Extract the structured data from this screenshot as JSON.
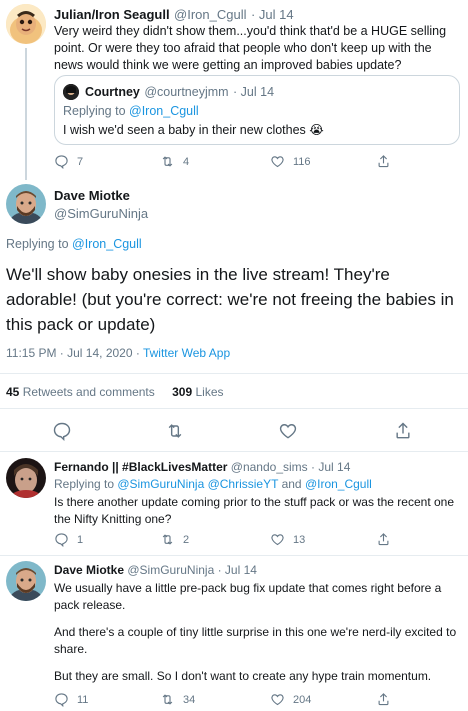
{
  "tweet1": {
    "name": "Julian/Iron Seagull",
    "handle": "@Iron_Cgull",
    "date": "· Jul 14",
    "text": "Very weird they didn't show them...you'd think that'd be a HUGE selling point. Or were they too afraid that people who don't keep up with the news would think we were getting an improved babies update?",
    "quote": {
      "name": "Courtney",
      "handle": "@courtneyjmm",
      "date": "· Jul 14",
      "replying_prefix": "Replying to ",
      "replying_handle": "@Iron_Cgull",
      "text": "I wish we'd seen a baby in their new clothes 😭"
    },
    "replies": "7",
    "retweets": "4",
    "likes": "116"
  },
  "main": {
    "name": "Dave Miotke",
    "handle": "@SimGuruNinja",
    "replying_prefix": "Replying to ",
    "replying_handle": "@Iron_Cgull",
    "text": "We'll show baby onesies in the live stream! They're adorable! (but you're correct: we're not freeing the babies in this pack or update)",
    "timestamp": "11:15 PM · Jul 14, 2020 · ",
    "source": "Twitter Web App",
    "retweets_count": "45",
    "retweets_label": "Retweets and comments",
    "likes_count": "309",
    "likes_label": "Likes"
  },
  "reply1": {
    "name": "Fernando || #BlackLivesMatter",
    "handle": "@nando_sims",
    "date": "· Jul 14",
    "replying_prefix": "Replying to ",
    "replying_handles": "@SimGuruNinja @ChrissieYT",
    "replying_and": " and ",
    "replying_last": "@Iron_Cgull",
    "text": "Is there another update coming prior to the stuff pack or was the recent one the Nifty Knitting one?",
    "replies": "1",
    "retweets": "2",
    "likes": "13"
  },
  "reply2": {
    "name": "Dave Miotke",
    "handle": "@SimGuruNinja",
    "date": "· Jul 14",
    "para1": "We usually have a little pre-pack bug fix update that comes right before a pack release.",
    "para2": "And there's a couple of tiny little surprise in this one we're nerd-ily excited to share.",
    "para3": "But they are small. So I don't want to create any hype train momentum.",
    "replies": "11",
    "retweets": "34",
    "likes": "204"
  },
  "colors": {
    "link": "#1b95e0",
    "muted": "#657786",
    "divider": "#e6ecf0",
    "text": "#14171a"
  }
}
